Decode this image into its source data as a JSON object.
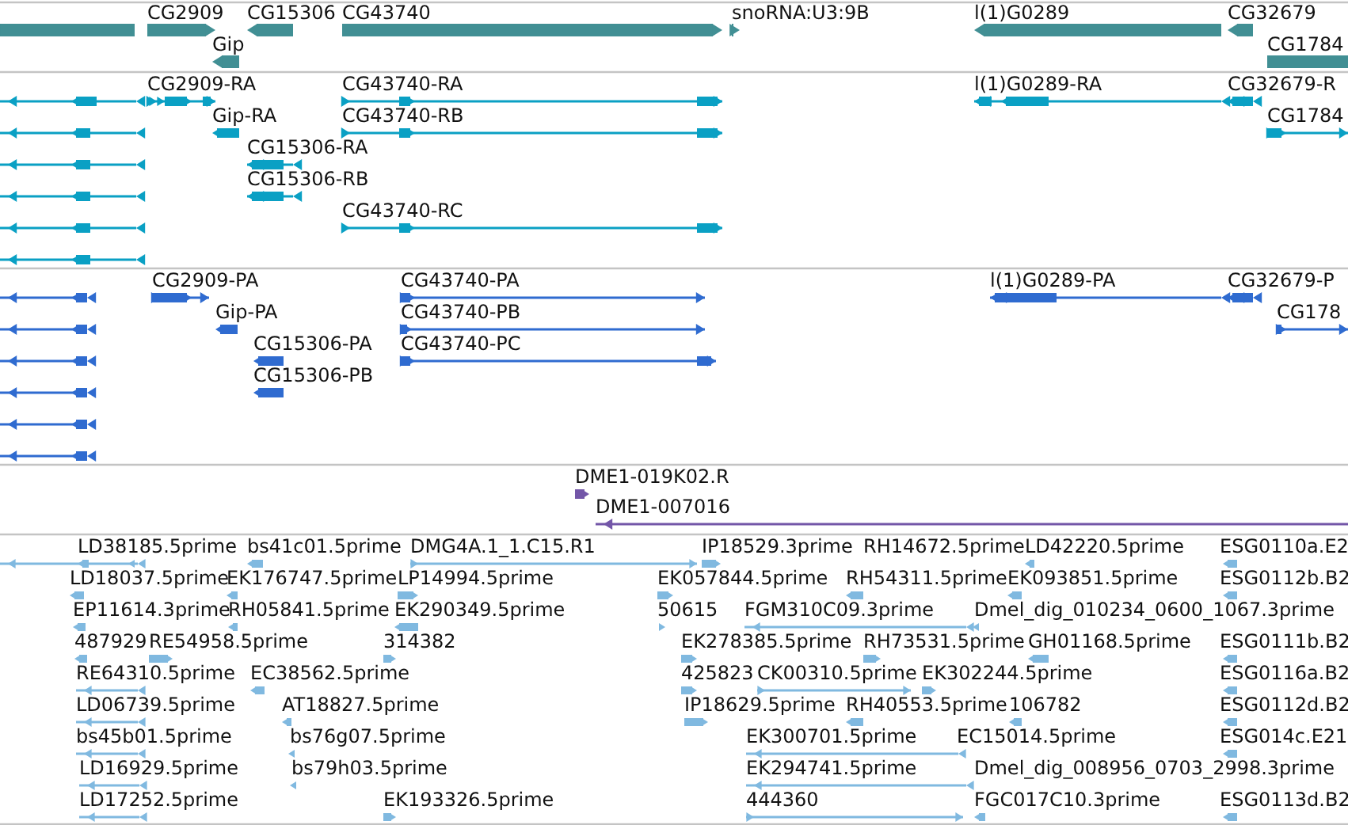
{
  "tracks": [
    {
      "kind": "gene",
      "features": [
        {
          "reverse_strand": true
        },
        {
          "label": "CG2909",
          "reverse_strand": false
        },
        {
          "label": "Gip",
          "reverse_strand": true
        },
        {
          "label": "CG15306",
          "reverse_strand": true
        },
        {
          "label": "CG43740",
          "reverse_strand": false
        },
        {
          "label": "snoRNA:U3:9B",
          "reverse_strand": false
        },
        {
          "label": "l(1)G0289",
          "reverse_strand": true
        },
        {
          "label": "CG32679",
          "reverse_strand": true
        },
        {
          "label": "CG1784",
          "reverse_strand": false
        }
      ]
    },
    {
      "kind": "mrna",
      "features": [
        {
          "reverse_strand": true
        },
        {
          "reverse_strand": true
        },
        {
          "reverse_strand": true
        },
        {
          "reverse_strand": true
        },
        {
          "reverse_strand": true
        },
        {
          "reverse_strand": true
        },
        {
          "label": "CG2909-RA",
          "reverse_strand": false
        },
        {
          "label": "Gip-RA",
          "reverse_strand": true
        },
        {
          "label": "CG15306-RA",
          "reverse_strand": true
        },
        {
          "label": "CG15306-RB",
          "reverse_strand": true
        },
        {
          "label": "CG43740-RA",
          "reverse_strand": false
        },
        {
          "label": "CG43740-RB",
          "reverse_strand": false
        },
        {
          "label": "CG43740-RC",
          "reverse_strand": false
        },
        {
          "label": "l(1)G0289-RA",
          "reverse_strand": true
        },
        {
          "label": "CG32679-R",
          "reverse_strand": true
        },
        {
          "label": "CG1784",
          "reverse_strand": false
        }
      ]
    },
    {
      "kind": "cds",
      "features": [
        {
          "reverse_strand": true
        },
        {
          "reverse_strand": true
        },
        {
          "reverse_strand": true
        },
        {
          "reverse_strand": true
        },
        {
          "reverse_strand": true
        },
        {
          "reverse_strand": true
        },
        {
          "label": "CG2909-PA",
          "reverse_strand": false
        },
        {
          "label": "Gip-PA",
          "reverse_strand": true
        },
        {
          "label": "CG15306-PA",
          "reverse_strand": true
        },
        {
          "label": "CG15306-PB",
          "reverse_strand": true
        },
        {
          "label": "CG43740-PA",
          "reverse_strand": false
        },
        {
          "label": "CG43740-PB",
          "reverse_strand": false
        },
        {
          "label": "CG43740-PC",
          "reverse_strand": false
        },
        {
          "label": "l(1)G0289-PA",
          "reverse_strand": true
        },
        {
          "label": "CG32679-P",
          "reverse_strand": true
        },
        {
          "label": "CG178",
          "reverse_strand": false
        }
      ]
    },
    {
      "kind": "clone",
      "features": [
        {
          "label": "DME1-019K02.R",
          "reverse_strand": false
        },
        {
          "label": "DME1-007016",
          "reverse_strand": true
        }
      ]
    },
    {
      "kind": "est",
      "features": [
        {
          "label": "LD38185.5prime",
          "reverse_strand": true
        },
        {
          "label": "bs41c01.5prime",
          "reverse_strand": true
        },
        {
          "label": "DMG4A.1_1.C15.R1",
          "reverse_strand": false
        },
        {
          "label": "IP18529.3prime",
          "reverse_strand": false
        },
        {
          "label": "RH14672.5prime"
        },
        {
          "label": "LD42220.5prime",
          "reverse_strand": true
        },
        {
          "label": "ESG0110a.E2",
          "reverse_strand": true
        },
        {
          "label": "LD18037.5prime",
          "reverse_strand": true
        },
        {
          "label": "EK176747.5prime",
          "reverse_strand": true
        },
        {
          "label": "LP14994.5prime",
          "reverse_strand": false
        },
        {
          "label": "EK057844.5prime",
          "reverse_strand": false
        },
        {
          "label": "RH54311.5prime",
          "reverse_strand": true
        },
        {
          "label": "EK093851.5prime",
          "reverse_strand": true
        },
        {
          "label": "ESG0112b.B2",
          "reverse_strand": true
        },
        {
          "label": "EP11614.3prime",
          "reverse_strand": true
        },
        {
          "label": "RH05841.5prime",
          "reverse_strand": true
        },
        {
          "label": "EK290349.5prime",
          "reverse_strand": true
        },
        {
          "label": "50615",
          "reverse_strand": false
        },
        {
          "label": "FGM310C09.3prime",
          "reverse_strand": true
        },
        {
          "label": "Dmel_dig_010234_0600_1067.3prime",
          "reverse_strand": true
        },
        {
          "label": "487929",
          "reverse_strand": true
        },
        {
          "label": "RE54958.5prime",
          "reverse_strand": false
        },
        {
          "label": "314382",
          "reverse_strand": false
        },
        {
          "label": "EK278385.5prime",
          "reverse_strand": false
        },
        {
          "label": "RH73531.5prime",
          "reverse_strand": false
        },
        {
          "label": "GH01168.5prime",
          "reverse_strand": true
        },
        {
          "label": "ESG0111b.B2",
          "reverse_strand": true
        },
        {
          "label": "RE64310.5prime",
          "reverse_strand": true
        },
        {
          "label": "EC38562.5prime",
          "reverse_strand": true
        },
        {
          "label": "425823",
          "reverse_strand": false
        },
        {
          "label": "CK00310.5prime",
          "reverse_strand": false
        },
        {
          "label": "EK302244.5prime",
          "reverse_strand": false
        },
        {
          "label": "ESG0116a.B2",
          "reverse_strand": true
        },
        {
          "label": "LD06739.5prime",
          "reverse_strand": true
        },
        {
          "label": "AT18827.5prime",
          "reverse_strand": true
        },
        {
          "label": "IP18629.5prime",
          "reverse_strand": false
        },
        {
          "label": "RH40553.5prime",
          "reverse_strand": true
        },
        {
          "label": "106782",
          "reverse_strand": true
        },
        {
          "label": "ESG0112d.B2",
          "reverse_strand": true
        },
        {
          "label": "bs45b01.5prime",
          "reverse_strand": true
        },
        {
          "label": "bs76g07.5prime",
          "reverse_strand": true
        },
        {
          "label": "EK300701.5prime",
          "reverse_strand": true
        },
        {
          "label": "EC15014.5prime"
        },
        {
          "label": "ESG014c.E21",
          "reverse_strand": true
        },
        {
          "label": "LD16929.5prime",
          "reverse_strand": true
        },
        {
          "label": "bs79h03.5prime",
          "reverse_strand": true
        },
        {
          "label": "EK294741.5prime",
          "reverse_strand": true
        },
        {
          "label": "Dmel_dig_008956_0703_2998.3prime"
        },
        {
          "label": "LD17252.5prime",
          "reverse_strand": true
        },
        {
          "label": "EK193326.5prime",
          "reverse_strand": false
        },
        {
          "label": "444360",
          "reverse_strand": false
        },
        {
          "label": "FGC017C10.3prime",
          "reverse_strand": true
        },
        {
          "label": "ESG0113d.B2",
          "reverse_strand": true
        }
      ]
    }
  ]
}
